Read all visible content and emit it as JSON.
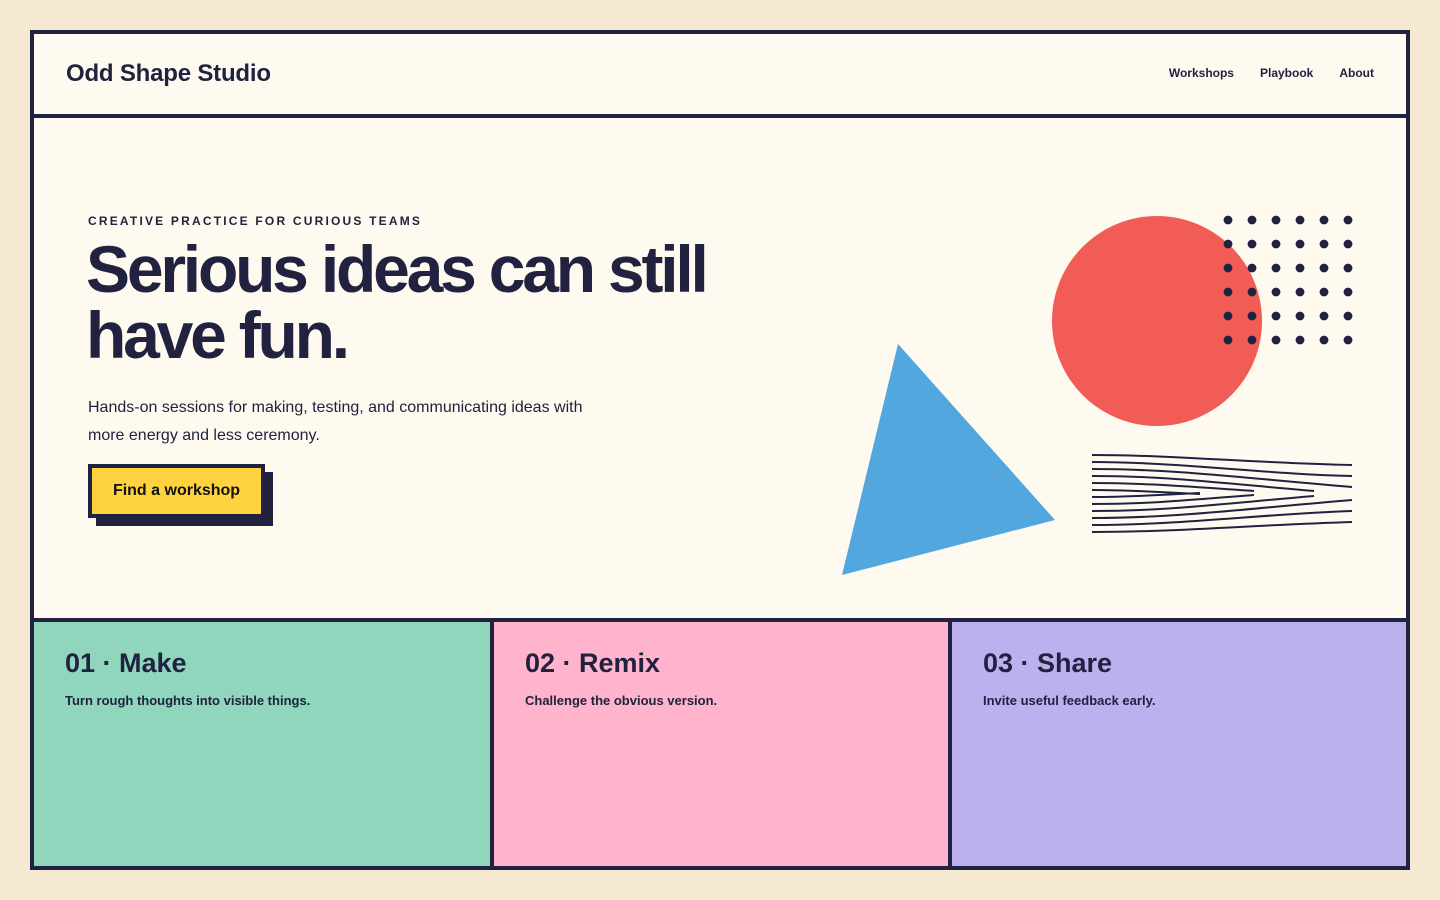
{
  "brand": {
    "name": "Odd Shape Studio"
  },
  "nav": {
    "items": [
      "Workshops",
      "Playbook",
      "About"
    ]
  },
  "hero": {
    "kicker": "CREATIVE PRACTICE FOR CURIOUS TEAMS",
    "headline": "Serious ideas can still have fun.",
    "lede": "Hands-on sessions for making, testing, and communicating ideas with more energy and less ceremony.",
    "cta_label": "Find a workshop",
    "decorations": [
      "dot-grid",
      "coral-circle",
      "blue-triangle",
      "ripple-lines"
    ]
  },
  "cards": [
    {
      "number": "01 · Make",
      "text": "Turn rough thoughts into visible things.",
      "color": "#8fd6bd"
    },
    {
      "number": "02 · Remix",
      "text": "Challenge the obvious version.",
      "color": "#ffb3cc"
    },
    {
      "number": "03 · Share",
      "text": "Invite useful feedback early.",
      "color": "#bdb0ef"
    }
  ],
  "colors": {
    "ink": "#20223f",
    "background": "#f6e9d1",
    "panel": "#fffaf0",
    "accent_yellow": "#ffd23f",
    "accent_coral": "#f15c56",
    "accent_blue": "#52a8de"
  }
}
